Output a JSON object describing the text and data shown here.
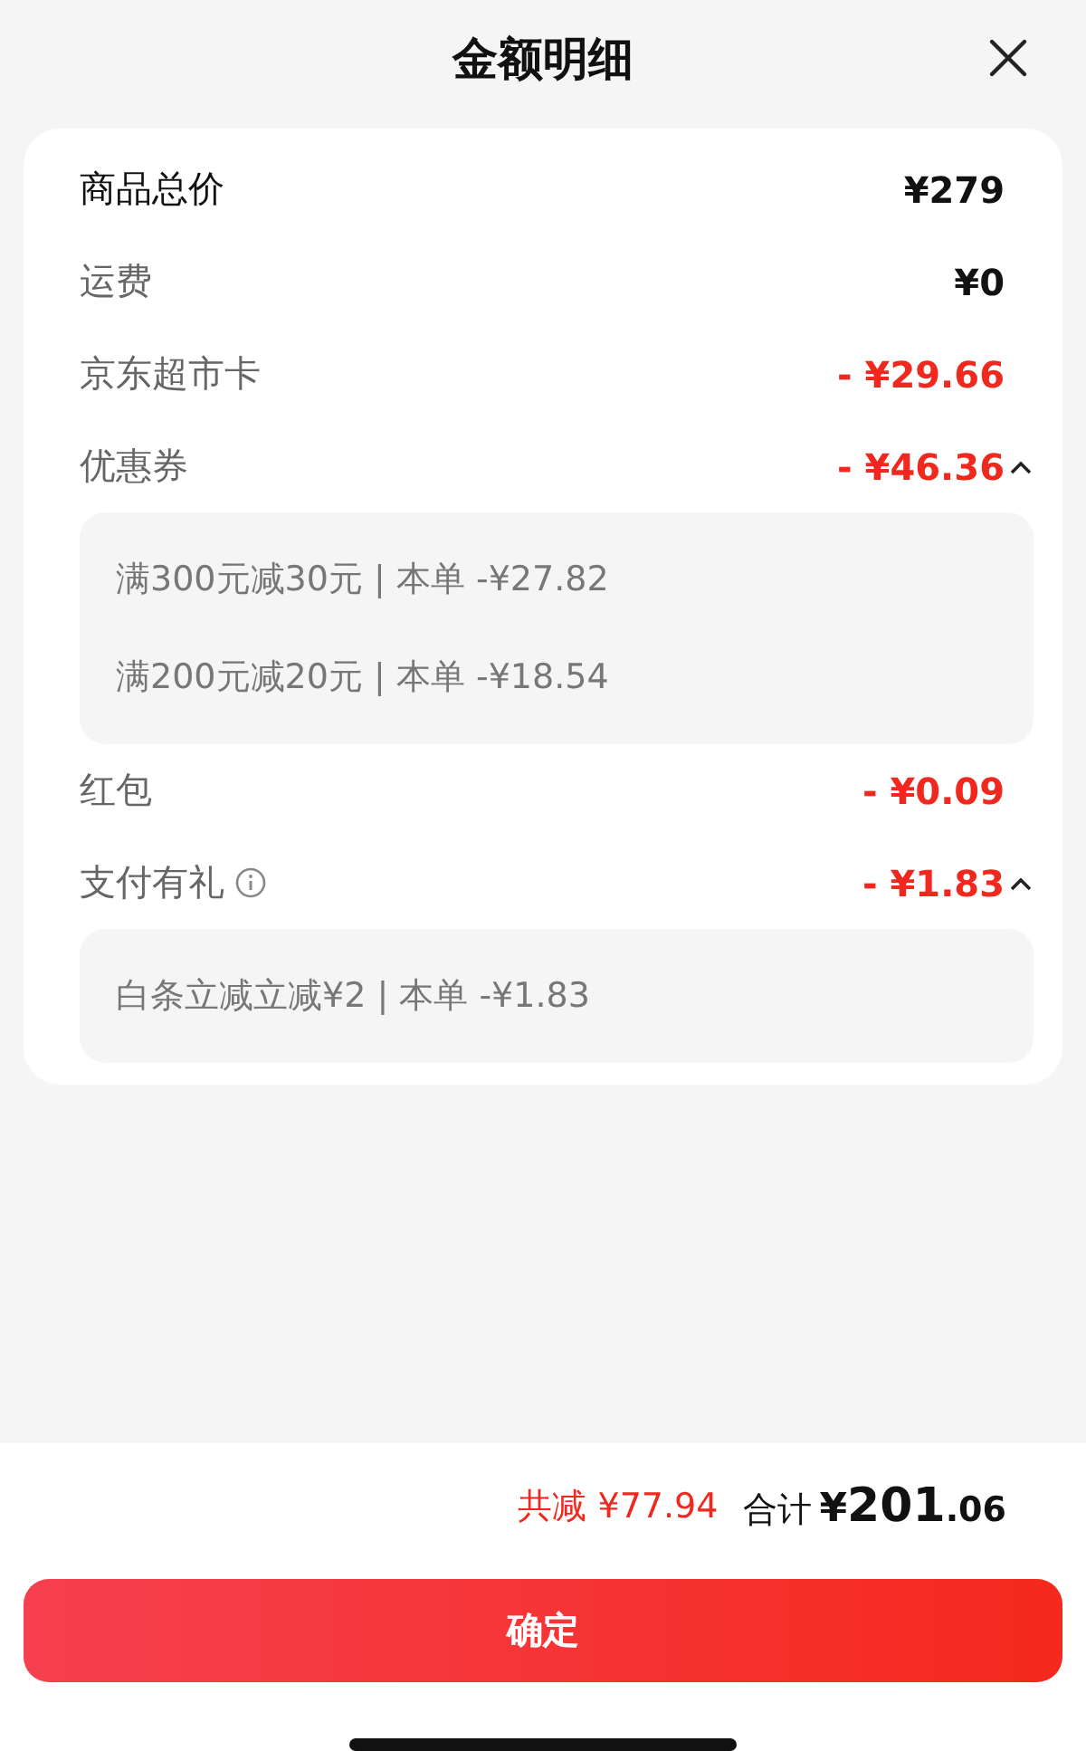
{
  "header": {
    "title": "金额明细"
  },
  "rows": [
    {
      "label": "商品总价",
      "amount": "¥279",
      "kind": "total"
    },
    {
      "label": "运费",
      "amount": "¥0",
      "kind": "fee"
    },
    {
      "label": "京东超市卡",
      "amount": "- ¥29.66",
      "kind": "discount"
    },
    {
      "label": "优惠券",
      "amount": "- ¥46.36",
      "kind": "discount",
      "expanded": true,
      "details": [
        "满300元减30元 | 本单 -¥27.82",
        "满200元减20元 | 本单 -¥18.54"
      ]
    },
    {
      "label": "红包",
      "amount": "- ¥0.09",
      "kind": "discount"
    },
    {
      "label": "支付有礼",
      "amount": "- ¥1.83",
      "kind": "discount",
      "info_icon": true,
      "expanded": true,
      "details": [
        "白条立减立减¥2 | 本单 -¥1.83"
      ]
    }
  ],
  "footer": {
    "saving": "共减 ¥77.94",
    "total_label": "合计",
    "currency": "¥",
    "total_integer": "201",
    "total_decimal": ".06"
  },
  "confirm_button": "确定"
}
